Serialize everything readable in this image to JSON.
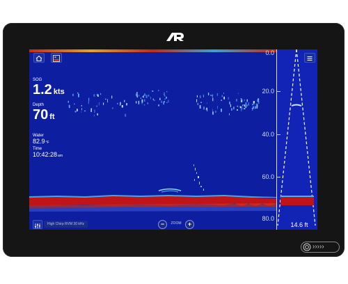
{
  "device": {
    "brand_logo": "raymarine-r-logo",
    "power_icon": "power-icon",
    "swipe_icon": "chevrons-right-icon"
  },
  "toolbar": {
    "home_icon": "home-icon",
    "sonar_icon": "sonar-app-icon",
    "menu_icon": "hamburger-menu-icon"
  },
  "readouts": {
    "sog": {
      "label": "SOG",
      "value": "1.2",
      "unit": "kts"
    },
    "depth": {
      "label": "Depth",
      "value": "70",
      "unit": "ft"
    },
    "water_temp": {
      "label": "Water",
      "value": "82.9",
      "unit": "°F"
    },
    "time": {
      "label": "Time",
      "value": "10:42:28",
      "unit": "am"
    }
  },
  "depth_scale": {
    "ticks": [
      "0.0",
      "20.0",
      "40.0",
      "60.0",
      "80.0"
    ],
    "range_readout": "14.6 ft"
  },
  "bottom_bar": {
    "filter_icon": "sliders-icon",
    "channel_label": "High Chirp RVM 30 kHz",
    "zoom_out": "−",
    "zoom_label": "ZOOM",
    "zoom_in": "+"
  },
  "colors": {
    "sonar_background": "#0d1fa0",
    "bottom_return": "#c0141a",
    "surface_clutter": "#e8a12a",
    "device_bezel": "#151515"
  }
}
